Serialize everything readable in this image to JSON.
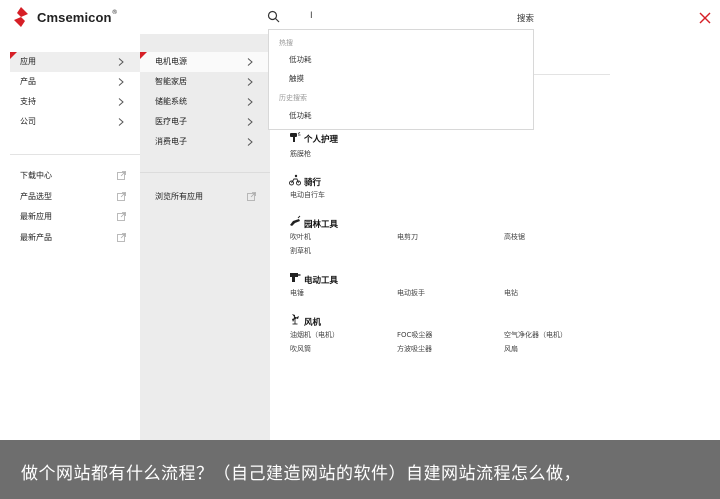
{
  "brand": {
    "name": "Cmsemicon",
    "reg": "®",
    "color": "#d61f26"
  },
  "search": {
    "label": "搜索"
  },
  "dropdown": {
    "hot_heading": "热搜",
    "hot_items": [
      "低功耗",
      "触摸"
    ],
    "history_heading": "历史搜索",
    "history_items": [
      "低功耗"
    ]
  },
  "nav_primary": [
    "应用",
    "产品",
    "支持",
    "公司"
  ],
  "nav_links": [
    "下载中心",
    "产品选型",
    "最新应用",
    "最新产品"
  ],
  "nav_secondary": [
    "电机电源",
    "智能家居",
    "储能系统",
    "医疗电子",
    "消费电子"
  ],
  "view_all": "浏览所有应用",
  "categories": [
    {
      "title": "个人护理",
      "icon": "hair-dryer-icon",
      "items": [
        "筋膜枪"
      ]
    },
    {
      "title": "骑行",
      "icon": "cycling-icon",
      "items": [
        "电动自行车"
      ]
    },
    {
      "title": "园林工具",
      "icon": "garden-tool-icon",
      "items": [
        "吹叶机",
        "电剪刀",
        "高枝锯",
        "割草机"
      ]
    },
    {
      "title": "电动工具",
      "icon": "power-drill-icon",
      "items": [
        "电锤",
        "电动扳手",
        "电钻"
      ]
    },
    {
      "title": "风机",
      "icon": "fan-icon",
      "items": [
        "油烟机（电机）",
        "FOC吸尘器",
        "空气净化器（电机）",
        "吹风筒",
        "方波吸尘器",
        "风扇"
      ]
    }
  ],
  "banner": {
    "text": "做个网站都有什么流程？（自己建造网站的软件）自建网站流程怎么做，"
  }
}
